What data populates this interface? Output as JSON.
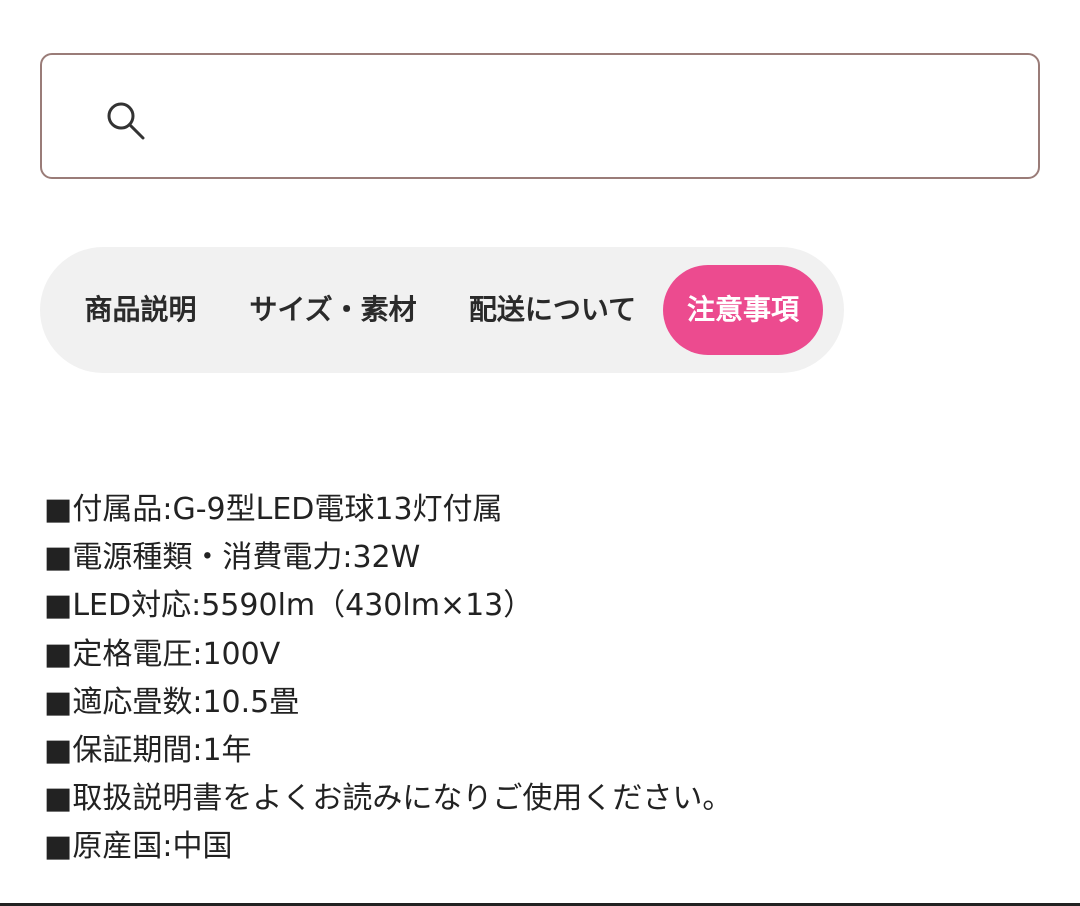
{
  "search": {
    "placeholder": "",
    "value": "",
    "icon": "search-icon"
  },
  "tabs": [
    {
      "label": "商品説明",
      "active": false
    },
    {
      "label": "サイズ・素材",
      "active": false
    },
    {
      "label": "配送について",
      "active": false
    },
    {
      "label": "注意事項",
      "active": true
    }
  ],
  "colors": {
    "accent": "#ec4b8f",
    "search_border": "#9a7c78",
    "tab_bar_bg": "#f1f1f1"
  },
  "notes": [
    "■付属品:G-9型LED電球13灯付属",
    "■電源種類・消費電力:32W",
    "■LED対応:5590lm（430lm×13）",
    "■定格電圧:100V",
    "■適応畳数:10.5畳",
    "■保証期間:1年",
    "■取扱説明書をよくお読みになりご使用ください。",
    "■原産国:中国"
  ]
}
